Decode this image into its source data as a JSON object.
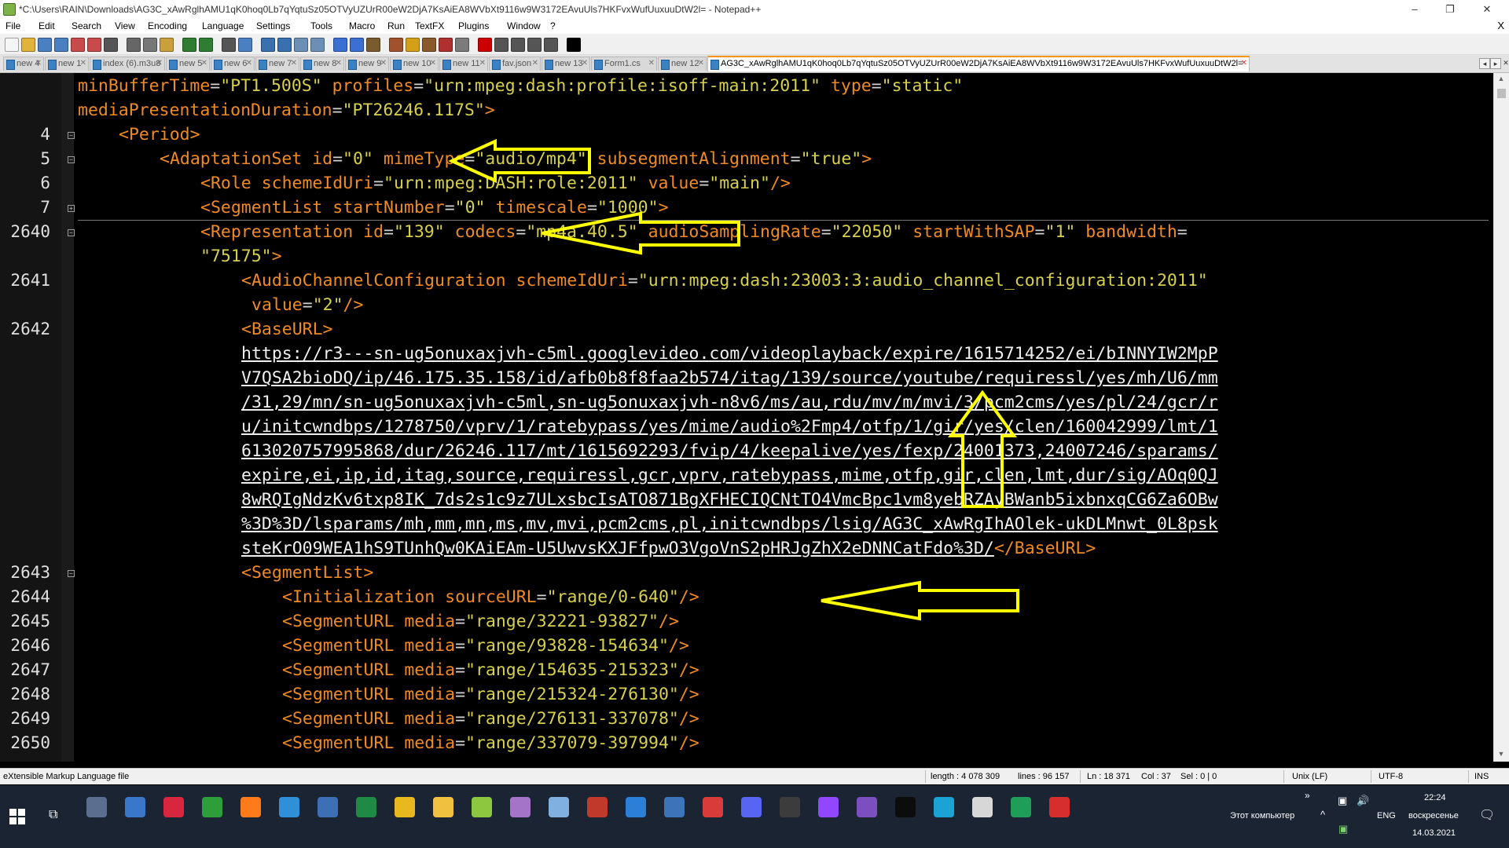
{
  "window": {
    "title": "*C:\\Users\\RAIN\\Downloads\\AG3C_xAwRglhAMU1qK0hoq0Lb7qYqtuSz05OTVyUZUrR00eW2DjA7KsAiEA8WVbXt9116w9W3172EAvuUls7HKFvxWufUuxuuDtW2l= - Notepad++",
    "minimize": "–",
    "maximize": "❐",
    "close": "✕"
  },
  "menu": {
    "items": [
      "File",
      "Edit",
      "Search",
      "View",
      "Encoding",
      "Language",
      "Settings",
      "Tools",
      "Macro",
      "Run",
      "TextFX",
      "Plugins",
      "Window",
      "?"
    ],
    "close_glyph": "X"
  },
  "toolbar": {
    "icons": [
      "new-file-icon",
      "open-file-icon",
      "save-icon",
      "save-all-icon",
      "close-icon",
      "close-all-icon",
      "print-icon",
      "cut-icon",
      "copy-icon",
      "paste-icon",
      "undo-icon",
      "redo-icon",
      "find-icon",
      "replace-icon",
      "zoom-in-icon",
      "zoom-out-icon",
      "sync-v-icon",
      "sync-h-icon",
      "word-wrap-icon",
      "show-all-chars-icon",
      "indent-guide-icon",
      "user-lang-icon",
      "doc-map-icon",
      "function-list-icon",
      "folder-workspace-icon",
      "monitor-icon",
      "record-macro-icon",
      "stop-macro-icon",
      "play-macro-icon",
      "run-macro-multiple-icon",
      "save-macro-icon",
      "spellcheck-icon"
    ],
    "colors": [
      "#f5f5f5",
      "#e2b33c",
      "#4a7fc1",
      "#4a7fc1",
      "#c94a4a",
      "#c94a4a",
      "#555555",
      "#666666",
      "#777777",
      "#c9a03c",
      "#2e7d32",
      "#2e7d32",
      "#555555",
      "#4a7fc1",
      "#3a6fb0",
      "#3a6fb0",
      "#6b8fb5",
      "#6b8fb5",
      "#3b6fd1",
      "#3b6fd1",
      "#7a5b2e",
      "#a0522d",
      "#d4a017",
      "#8b5a2b",
      "#b03030",
      "#7b7b7b",
      "#cc0000",
      "#555555",
      "#555555",
      "#555555",
      "#555555",
      "#000000"
    ]
  },
  "tabs": [
    {
      "label": "new 4",
      "width": 52
    },
    {
      "label": "new 1",
      "width": 56
    },
    {
      "label": "index (6).m3u8",
      "width": 96
    },
    {
      "label": "new 5",
      "width": 56
    },
    {
      "label": "new 6",
      "width": 56
    },
    {
      "label": "new 7",
      "width": 56
    },
    {
      "label": "new 8",
      "width": 56
    },
    {
      "label": "new 9",
      "width": 56
    },
    {
      "label": "new 10",
      "width": 62
    },
    {
      "label": "new 11",
      "width": 62
    },
    {
      "label": "fav.json",
      "width": 66
    },
    {
      "label": "new 13",
      "width": 62
    },
    {
      "label": "Form1.cs",
      "width": 84
    },
    {
      "label": "new 12",
      "width": 62
    },
    {
      "label": "AG3C_xAwRglhAMU1qK0hoq0Lb7qYqtuSz05OTVyUZUrR00eW2DjA7KsAiEA8WVbXt9116w9W3172EAvuUls7HKFvxWufUuxuuDtW2l=",
      "width": 690,
      "active": true
    }
  ],
  "tab_close_glyph": "✕",
  "tab_nav": {
    "left": "◂",
    "right": "▸",
    "close": "✕"
  },
  "editor": {
    "line_numbers": [
      {
        "n": "",
        "row": 0
      },
      {
        "n": "",
        "row": 1
      },
      {
        "n": "4",
        "row": 2,
        "fold": "−"
      },
      {
        "n": "5",
        "row": 3,
        "fold": "−"
      },
      {
        "n": "6",
        "row": 4
      },
      {
        "n": "7",
        "row": 5,
        "fold": "+"
      },
      {
        "n": "2640",
        "row": 6,
        "fold": "−"
      },
      {
        "n": "",
        "row": 7
      },
      {
        "n": "2641",
        "row": 8
      },
      {
        "n": "",
        "row": 9
      },
      {
        "n": "2642",
        "row": 10
      },
      {
        "n": "2643",
        "row": 20,
        "fold": "−"
      },
      {
        "n": "2644",
        "row": 21
      },
      {
        "n": "2645",
        "row": 22
      },
      {
        "n": "2646",
        "row": 23
      },
      {
        "n": "2647",
        "row": 24
      },
      {
        "n": "2648",
        "row": 25
      },
      {
        "n": "2649",
        "row": 26
      },
      {
        "n": "2650",
        "row": 27
      }
    ],
    "lines": [
      {
        "indent": 0,
        "tokens": [
          [
            "at",
            "minBufferTime"
          ],
          [
            "eq",
            "="
          ],
          [
            "vl",
            "\"PT1.500S\""
          ],
          [
            "tx",
            " "
          ],
          [
            "at",
            "profiles"
          ],
          [
            "eq",
            "="
          ],
          [
            "vl",
            "\"urn:mpeg:dash:profile:isoff-main:2011\""
          ],
          [
            "tx",
            " "
          ],
          [
            "at",
            "type"
          ],
          [
            "eq",
            "="
          ],
          [
            "vl",
            "\"static\""
          ]
        ]
      },
      {
        "indent": 0,
        "tokens": [
          [
            "at",
            "mediaPresentationDuration"
          ],
          [
            "eq",
            "="
          ],
          [
            "vl",
            "\"PT26246.117S\""
          ],
          [
            "tg",
            ">"
          ]
        ]
      },
      {
        "indent": 4,
        "tokens": [
          [
            "tg",
            "<Period>"
          ]
        ]
      },
      {
        "indent": 8,
        "tokens": [
          [
            "tg",
            "<AdaptationSet"
          ],
          [
            "tx",
            " "
          ],
          [
            "at",
            "id"
          ],
          [
            "eq",
            "="
          ],
          [
            "vl",
            "\"0\""
          ],
          [
            "tx",
            " "
          ],
          [
            "at",
            "mimeType"
          ],
          [
            "eq",
            "="
          ],
          [
            "vl",
            "\"audio/mp4\""
          ],
          [
            "tx",
            " "
          ],
          [
            "at",
            "subsegmentAlignment"
          ],
          [
            "eq",
            "="
          ],
          [
            "vl",
            "\"true\""
          ],
          [
            "tg",
            ">"
          ]
        ]
      },
      {
        "indent": 12,
        "tokens": [
          [
            "tg",
            "<Role"
          ],
          [
            "tx",
            " "
          ],
          [
            "at",
            "schemeIdUri"
          ],
          [
            "eq",
            "="
          ],
          [
            "vl",
            "\"urn:mpeg:DASH:role:2011\""
          ],
          [
            "tx",
            " "
          ],
          [
            "at",
            "value"
          ],
          [
            "eq",
            "="
          ],
          [
            "vl",
            "\"main\""
          ],
          [
            "tg",
            "/>"
          ]
        ]
      },
      {
        "indent": 12,
        "tokens": [
          [
            "tg",
            "<SegmentList"
          ],
          [
            "tx",
            " "
          ],
          [
            "at",
            "startNumber"
          ],
          [
            "eq",
            "="
          ],
          [
            "vl",
            "\"0\""
          ],
          [
            "tx",
            " "
          ],
          [
            "at",
            "timescale"
          ],
          [
            "eq",
            "="
          ],
          [
            "vl",
            "\"1000\""
          ],
          [
            "tg",
            ">"
          ]
        ]
      },
      {
        "indent": 12,
        "tokens": [
          [
            "tg",
            "<Representation"
          ],
          [
            "tx",
            " "
          ],
          [
            "at",
            "id"
          ],
          [
            "eq",
            "="
          ],
          [
            "vl",
            "\"139\""
          ],
          [
            "tx",
            " "
          ],
          [
            "at",
            "codecs"
          ],
          [
            "eq",
            "="
          ],
          [
            "vl",
            "\"mp4a.40.5\""
          ],
          [
            "tx",
            " "
          ],
          [
            "at",
            "audioSamplingRate"
          ],
          [
            "eq",
            "="
          ],
          [
            "vl",
            "\"22050\""
          ],
          [
            "tx",
            " "
          ],
          [
            "at",
            "startWithSAP"
          ],
          [
            "eq",
            "="
          ],
          [
            "vl",
            "\"1\""
          ],
          [
            "tx",
            " "
          ],
          [
            "at",
            "bandwidth"
          ],
          [
            "eq",
            "="
          ]
        ]
      },
      {
        "indent": 12,
        "tokens": [
          [
            "vl",
            "\"75175\""
          ],
          [
            "tg",
            ">"
          ]
        ]
      },
      {
        "indent": 16,
        "tokens": [
          [
            "tg",
            "<AudioChannelConfiguration"
          ],
          [
            "tx",
            " "
          ],
          [
            "at",
            "schemeIdUri"
          ],
          [
            "eq",
            "="
          ],
          [
            "vl",
            "\"urn:mpeg:dash:23003:3:audio_channel_configuration:2011\""
          ]
        ]
      },
      {
        "indent": 17,
        "tokens": [
          [
            "at",
            "value"
          ],
          [
            "eq",
            "="
          ],
          [
            "vl",
            "\"2\""
          ],
          [
            "tg",
            "/>"
          ]
        ]
      },
      {
        "indent": 16,
        "tokens": [
          [
            "tg",
            "<BaseURL>"
          ]
        ]
      },
      {
        "indent": 16,
        "tokens": [
          [
            "url",
            "https://r3---sn-ug5onuxaxjvh-c5ml.googlevideo.com/videoplayback/expire/1615714252/ei/bINNYIW2MpP"
          ]
        ]
      },
      {
        "indent": 16,
        "tokens": [
          [
            "url",
            "V7QSA2bioDQ/ip/46.175.35.158/id/afb0b8f8faa2b574/itag/139/source/youtube/requiressl/yes/mh/U6/mm"
          ]
        ]
      },
      {
        "indent": 16,
        "tokens": [
          [
            "url",
            "/31,29/mn/sn-ug5onuxaxjvh-c5ml,sn-ug5onuxaxjvh-n8v6/ms/au,rdu/mv/m/mvi/3/pcm2cms/yes/pl/24/gcr/r"
          ]
        ]
      },
      {
        "indent": 16,
        "tokens": [
          [
            "url",
            "u/initcwndbps/1278750/vprv/1/ratebypass/yes/mime/audio%2Fmp4/otfp/1/gir/yes/clen/160042999/lmt/1"
          ]
        ]
      },
      {
        "indent": 16,
        "tokens": [
          [
            "url",
            "613020757995868/dur/26246.117/mt/1615692293/fvip/4/keepalive/yes/fexp/24001373,24007246/sparams/"
          ]
        ]
      },
      {
        "indent": 16,
        "tokens": [
          [
            "url",
            "expire,ei,ip,id,itag,source,requiressl,gcr,vprv,ratebypass,mime,otfp,gir,clen,lmt,dur/sig/AOq0QJ"
          ]
        ]
      },
      {
        "indent": 16,
        "tokens": [
          [
            "url",
            "8wRQIgNdzKv6txp8IK_7ds2s1c9z7ULxsbcIsATO871BgXFHECIQCNtTO4VmcBpc1vm8yebRZAyBWanb5ixbnxqCG6Za6OBw"
          ]
        ]
      },
      {
        "indent": 16,
        "tokens": [
          [
            "url",
            "%3D%3D/lsparams/mh,mm,mn,ms,mv,mvi,pcm2cms,pl,initcwndbps/lsig/AG3C_xAwRgIhAOlek-ukDLMnwt_0L8psk"
          ]
        ]
      },
      {
        "indent": 16,
        "tokens": [
          [
            "url",
            "steKrO09WEA1hS9TUnhQw0KAiEAm-U5UwvsKXJFfpwO3VgoVnS2pHRJgZhX2eDNNCatFdo%3D/"
          ],
          [
            "tg",
            "</BaseURL>"
          ]
        ]
      },
      {
        "indent": 16,
        "tokens": [
          [
            "tg",
            "<SegmentList>"
          ]
        ]
      },
      {
        "indent": 20,
        "tokens": [
          [
            "tg",
            "<Initialization"
          ],
          [
            "tx",
            " "
          ],
          [
            "at",
            "sourceURL"
          ],
          [
            "eq",
            "="
          ],
          [
            "vl",
            "\"range/0-640\""
          ],
          [
            "tg",
            "/>"
          ]
        ]
      },
      {
        "indent": 20,
        "tokens": [
          [
            "tg",
            "<SegmentURL"
          ],
          [
            "tx",
            " "
          ],
          [
            "at",
            "media"
          ],
          [
            "eq",
            "="
          ],
          [
            "vl",
            "\"range/32221-93827\""
          ],
          [
            "tg",
            "/>"
          ]
        ]
      },
      {
        "indent": 20,
        "tokens": [
          [
            "tg",
            "<SegmentURL"
          ],
          [
            "tx",
            " "
          ],
          [
            "at",
            "media"
          ],
          [
            "eq",
            "="
          ],
          [
            "vl",
            "\"range/93828-154634\""
          ],
          [
            "tg",
            "/>"
          ]
        ]
      },
      {
        "indent": 20,
        "tokens": [
          [
            "tg",
            "<SegmentURL"
          ],
          [
            "tx",
            " "
          ],
          [
            "at",
            "media"
          ],
          [
            "eq",
            "="
          ],
          [
            "vl",
            "\"range/154635-215323\""
          ],
          [
            "tg",
            "/>"
          ]
        ]
      },
      {
        "indent": 20,
        "tokens": [
          [
            "tg",
            "<SegmentURL"
          ],
          [
            "tx",
            " "
          ],
          [
            "at",
            "media"
          ],
          [
            "eq",
            "="
          ],
          [
            "vl",
            "\"range/215324-276130\""
          ],
          [
            "tg",
            "/>"
          ]
        ]
      },
      {
        "indent": 20,
        "tokens": [
          [
            "tg",
            "<SegmentURL"
          ],
          [
            "tx",
            " "
          ],
          [
            "at",
            "media"
          ],
          [
            "eq",
            "="
          ],
          [
            "vl",
            "\"range/276131-337078\""
          ],
          [
            "tg",
            "/>"
          ]
        ]
      },
      {
        "indent": 20,
        "tokens": [
          [
            "tg",
            "<SegmentURL"
          ],
          [
            "tx",
            " "
          ],
          [
            "at",
            "media"
          ],
          [
            "eq",
            "="
          ],
          [
            "vl",
            "\"range/337079-397994\""
          ],
          [
            "tg",
            "/>"
          ]
        ]
      }
    ]
  },
  "statusbar": {
    "filetype": "eXtensible Markup Language file",
    "length": "length : 4 078 309",
    "lines": "lines : 96 157",
    "position": "Ln : 18 371",
    "column": "Col : 37",
    "selection": "Sel : 0 | 0",
    "eol": "Unix (LF)",
    "encoding": "UTF-8",
    "mode": "INS"
  },
  "taskbar": {
    "apps": [
      {
        "name": "calculator-app-icon",
        "color": "#5a6f8f"
      },
      {
        "name": "xp-app-icon",
        "color": "#3a76c9"
      },
      {
        "name": "opera-app-icon",
        "color": "#d7263d"
      },
      {
        "name": "green-app-icon",
        "color": "#2e9e3a"
      },
      {
        "name": "firefox-app-icon",
        "color": "#ff7a18"
      },
      {
        "name": "remote-desktop-app-icon",
        "color": "#2f8fd8"
      },
      {
        "name": "docs-app-icon",
        "color": "#3d6fb6"
      },
      {
        "name": "cherry-app-icon",
        "color": "#1f8a46"
      },
      {
        "name": "chrome-app-icon",
        "color": "#e9b81f"
      },
      {
        "name": "explorer-app-icon",
        "color": "#f0c040"
      },
      {
        "name": "notepad-plus-app-icon",
        "color": "#8dc63f"
      },
      {
        "name": "butterfly-app-icon",
        "color": "#a474c8"
      },
      {
        "name": "cube-app-icon",
        "color": "#7fb0e0"
      },
      {
        "name": "red-z-app-icon",
        "color": "#c0392b"
      },
      {
        "name": "soccer-app-icon",
        "color": "#2c7fd6"
      },
      {
        "name": "l-app-icon",
        "color": "#3d73b8"
      },
      {
        "name": "dx-app-icon",
        "color": "#d93b3b"
      },
      {
        "name": "discord-app-icon",
        "color": "#5865f2"
      },
      {
        "name": "obs-app-icon",
        "color": "#3c3c3c"
      },
      {
        "name": "twitch-app-icon",
        "color": "#9146ff"
      },
      {
        "name": "visual-studio-app-icon",
        "color": "#7b4fbf"
      },
      {
        "name": "terminal-app-icon",
        "color": "#0c0c0c"
      },
      {
        "name": "vpn-app-icon",
        "color": "#1ba3d6"
      },
      {
        "name": "window-app-icon",
        "color": "#d7d7d7"
      },
      {
        "name": "pycharm-app-icon",
        "color": "#1f9e5a"
      },
      {
        "name": "rx-app-icon",
        "color": "#d62e2e"
      }
    ],
    "tray_label": "Этот компьютер",
    "lang": "ENG",
    "time": "22:24",
    "day": "воскресенье",
    "date": "14.03.2021"
  }
}
